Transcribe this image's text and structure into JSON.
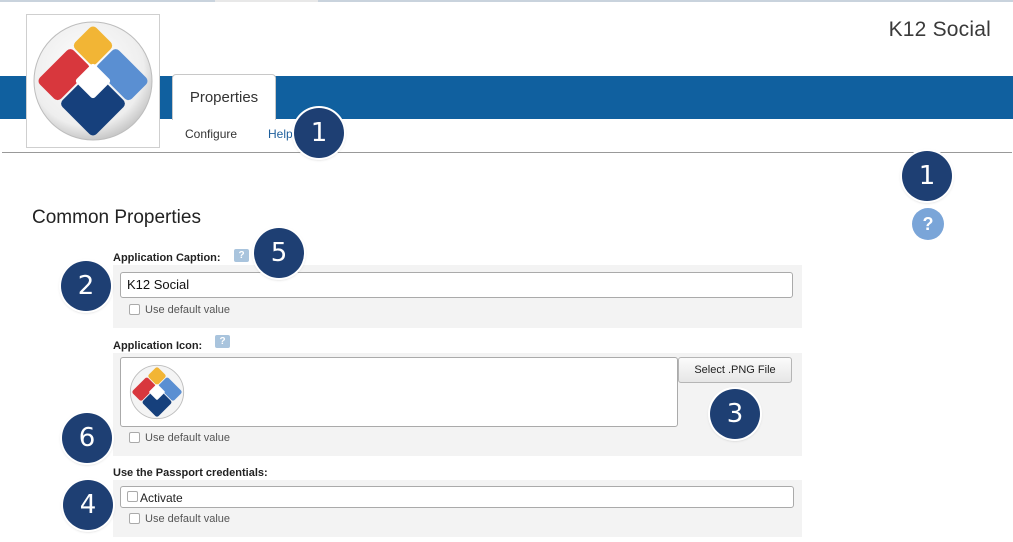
{
  "app": {
    "title": "K12 Social"
  },
  "tabs": [
    {
      "label": "Properties",
      "active": true
    }
  ],
  "subnav": [
    {
      "label": "Configure"
    },
    {
      "label": "Help"
    }
  ],
  "section": {
    "title": "Common Properties"
  },
  "fields": {
    "caption": {
      "label": "Application Caption:",
      "value": "K12 Social",
      "default_label": "Use default value",
      "default_checked": false
    },
    "icon": {
      "label": "Application Icon:",
      "button": "Select .PNG File",
      "default_label": "Use default value",
      "default_checked": false
    },
    "passport": {
      "label": "Use the Passport credentials:",
      "activate_label": "Activate",
      "activate_checked": false,
      "default_label": "Use default value",
      "default_checked": false
    }
  },
  "help_icon": "?",
  "callouts": [
    "1",
    "1",
    "2",
    "3",
    "4",
    "5",
    "6"
  ],
  "colors": {
    "band": "#10609f",
    "callout": "#1e3f73",
    "help": "#7aa5d8",
    "link": "#1e5f9c"
  }
}
